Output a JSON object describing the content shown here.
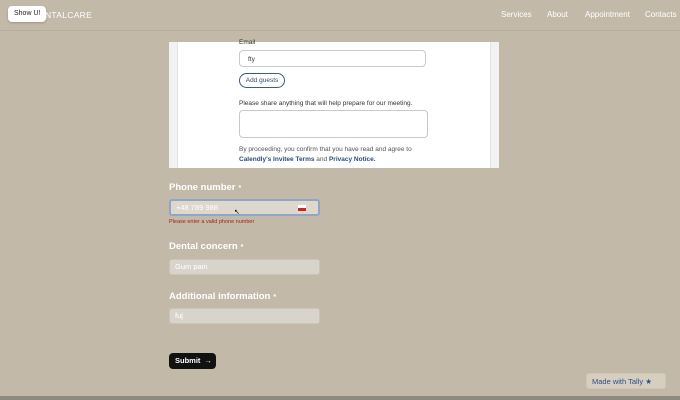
{
  "header": {
    "show_ui": "Show UI",
    "brand": "ENTALCARE",
    "nav": [
      "Services",
      "About",
      "Appointment",
      "Contacts"
    ]
  },
  "calendly": {
    "email_label": "Email",
    "email_value": "fty",
    "add_guests": "Add guests",
    "share_label": "Please share anything that will help prepare for our meeting.",
    "consent_line1": "By proceeding, you confirm that you have read and agree to",
    "invitee_terms": "Calendly's Invitee Terms",
    "and": "and",
    "privacy": "Privacy Notice."
  },
  "form": {
    "phone": {
      "label": "Phone number",
      "required": "*",
      "placeholder": "+48 789 988",
      "error": "Please enter a valid phone number"
    },
    "concern": {
      "label": "Dental concern",
      "required": "*",
      "placeholder": "Gum pain"
    },
    "additional": {
      "label": "Additional information",
      "required": "*",
      "placeholder": "fuj"
    },
    "submit": "Submit",
    "submit_arrow": "→"
  },
  "footer": {
    "made_with": "Made with Tally",
    "star": "★"
  },
  "colors": {
    "background": "#c2b9a9",
    "link": "#2b4c7e",
    "error": "#a11f1f",
    "button": "#111111"
  }
}
